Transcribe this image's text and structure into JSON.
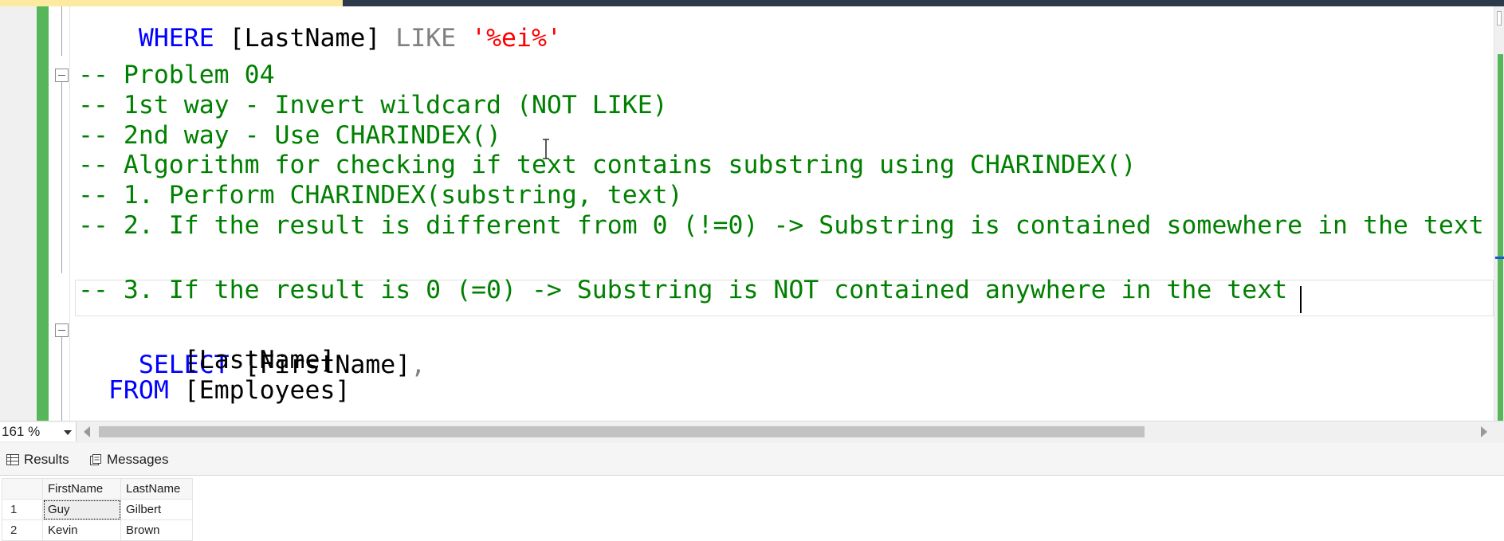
{
  "editor": {
    "truncated_line_segments": [
      {
        "text": "WHERE ",
        "class": "kw"
      },
      {
        "text": "[LastName]",
        "class": "id"
      },
      {
        "text": " LIKE ",
        "class": "op"
      },
      {
        "text": "'%ei%'",
        "class": "str"
      }
    ],
    "lines": [
      {
        "text": "-- Problem 04",
        "kind": "comment"
      },
      {
        "text": "-- 1st way - Invert wildcard (NOT LIKE)",
        "kind": "comment"
      },
      {
        "text": "-- 2nd way - Use CHARINDEX()",
        "kind": "comment"
      },
      {
        "text": "-- Algorithm for checking if text contains substring using CHARINDEX()",
        "kind": "comment"
      },
      {
        "text": "-- 1. Perform CHARINDEX(substring, text)",
        "kind": "comment"
      },
      {
        "text": "-- 2. If the result is different from 0 (!=0) -> Substring is contained somewhere in the text",
        "kind": "comment"
      },
      {
        "text": "-- 3. If the result is 0 (=0) -> Substring is NOT contained anywhere in the text",
        "kind": "comment"
      }
    ],
    "select_line": {
      "keyword": "SELECT",
      "column": "[FirstName]",
      "comma": ","
    },
    "column_line": {
      "column": "[LastName]"
    },
    "from_line": {
      "keyword": "FROM",
      "table": "[Employees]"
    }
  },
  "zoom": {
    "value": "161 %"
  },
  "results_tabs": {
    "results_label": "Results",
    "messages_label": "Messages"
  },
  "results_grid": {
    "columns": [
      "FirstName",
      "LastName"
    ],
    "rows": [
      {
        "num": "1",
        "first": "Guy",
        "last": "Gilbert"
      },
      {
        "num": "2",
        "first": "Kevin",
        "last": "Brown"
      }
    ]
  },
  "colors": {
    "comment": "#008000",
    "keyword": "#0000ff",
    "change_bar": "#57b65a"
  }
}
